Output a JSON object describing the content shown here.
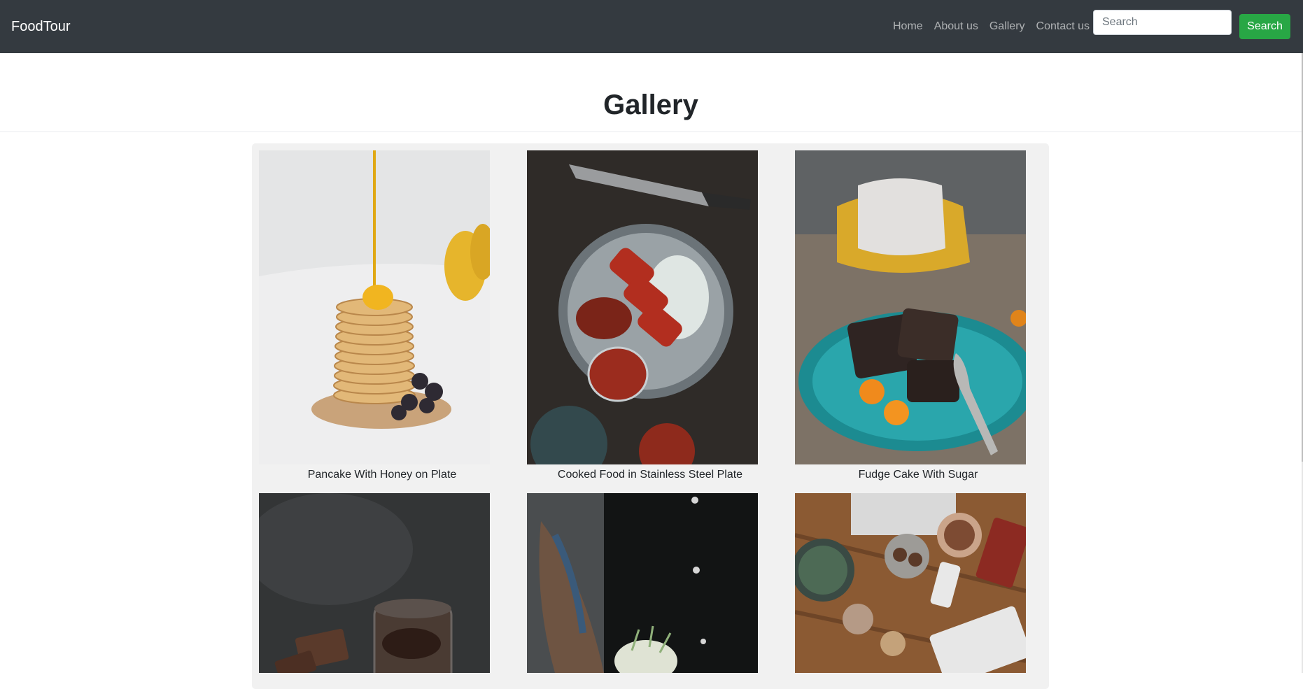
{
  "navbar": {
    "brand": "FoodTour",
    "links": [
      "Home",
      "About us",
      "Gallery",
      "Contact us"
    ],
    "search_placeholder": "Search",
    "search_button": "Search",
    "background": "#343a40",
    "button_color": "#28a745"
  },
  "page": {
    "title": "Gallery"
  },
  "gallery": {
    "items": [
      {
        "caption": "Pancake With Honey on Plate"
      },
      {
        "caption": "Cooked Food in Stainless Steel Plate"
      },
      {
        "caption": "Fudge Cake With Sugar"
      },
      {
        "caption": ""
      },
      {
        "caption": ""
      },
      {
        "caption": ""
      }
    ]
  }
}
